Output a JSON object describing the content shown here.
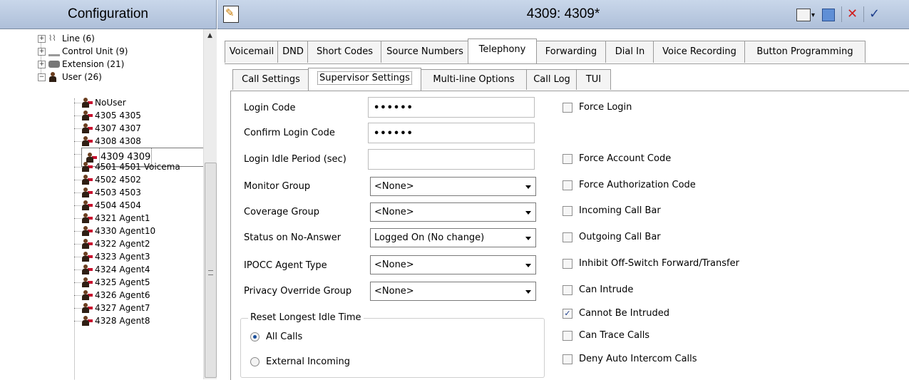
{
  "nav": {
    "title": "Configuration",
    "tree": [
      {
        "label": "Line (6)",
        "type": "line"
      },
      {
        "label": "Control Unit (9)",
        "type": "control"
      },
      {
        "label": "Extension (21)",
        "type": "extension"
      },
      {
        "label": "User (26)",
        "type": "user-group"
      },
      {
        "label": "NoUser"
      },
      {
        "label": "4305 4305"
      },
      {
        "label": "4307 4307"
      },
      {
        "label": "4308 4308"
      },
      {
        "label": "4309 4309",
        "selected": true
      },
      {
        "label": "4501 4501 Voicema"
      },
      {
        "label": "4502 4502"
      },
      {
        "label": "4503 4503"
      },
      {
        "label": "4504 4504"
      },
      {
        "label": "4321 Agent1"
      },
      {
        "label": "4330 Agent10"
      },
      {
        "label": "4322 Agent2"
      },
      {
        "label": "4323 Agent3"
      },
      {
        "label": "4324 Agent4"
      },
      {
        "label": "4325 Agent5"
      },
      {
        "label": "4326 Agent6"
      },
      {
        "label": "4327 Agent7"
      },
      {
        "label": "4328 Agent8"
      }
    ]
  },
  "header": {
    "title": "4309: 4309*",
    "icons": [
      "edit-record-icon",
      "new-record-icon",
      "save-icon",
      "cancel-icon",
      "ok-icon"
    ],
    "cancel_glyph": "✕",
    "ok_glyph": "✓"
  },
  "tabs": [
    "Voicemail",
    "DND",
    "Short Codes",
    "Source Numbers",
    "Telephony",
    "Forwarding",
    "Dial In",
    "Voice Recording",
    "Button Programming"
  ],
  "active_tab": "Telephony",
  "subtabs": [
    "Call Settings",
    "Supervisor Settings",
    "Multi-line Options",
    "Call Log",
    "TUI"
  ],
  "active_subtab": "Supervisor Settings",
  "form": {
    "login_code": {
      "label": "Login Code",
      "value": "••••••"
    },
    "confirm_login_code": {
      "label": "Confirm Login Code",
      "value": "••••••"
    },
    "login_idle_period": {
      "label": "Login Idle Period (sec)",
      "value": ""
    },
    "monitor_group": {
      "label": "Monitor Group",
      "value": "<None>"
    },
    "coverage_group": {
      "label": "Coverage Group",
      "value": "<None>"
    },
    "status_on_no_answer": {
      "label": "Status on No-Answer",
      "value": "Logged On (No change)"
    },
    "ipocc_agent_type": {
      "label": "IPOCC Agent Type",
      "value": "<None>"
    },
    "privacy_override_group": {
      "label": "Privacy Override Group",
      "value": "<None>"
    }
  },
  "reset_idle": {
    "title": "Reset Longest Idle Time",
    "options": [
      {
        "label": "All Calls",
        "selected": true
      },
      {
        "label": "External Incoming",
        "selected": false
      }
    ]
  },
  "checkboxes": [
    {
      "label": "Force Login",
      "checked": false
    },
    {
      "label": "Force Account Code",
      "checked": false
    },
    {
      "label": "Force Authorization Code",
      "checked": false
    },
    {
      "label": "Incoming Call Bar",
      "checked": false
    },
    {
      "label": "Outgoing Call Bar",
      "checked": false
    },
    {
      "label": "Inhibit Off-Switch Forward/Transfer",
      "checked": false
    },
    {
      "label": "Can Intrude",
      "checked": false
    },
    {
      "label": "Cannot Be Intruded",
      "checked": true
    },
    {
      "label": "Can Trace Calls",
      "checked": false
    },
    {
      "label": "Deny Auto Intercom Calls",
      "checked": false
    }
  ],
  "check_glyph": "✓"
}
